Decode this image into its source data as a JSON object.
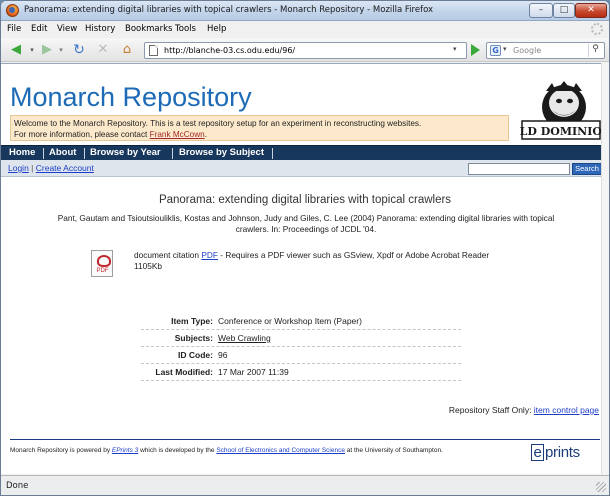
{
  "window": {
    "title": "Panorama: extending digital libraries with topical crawlers - Monarch Repository - Mozilla Firefox",
    "min_symbol": "–",
    "max_symbol": "□",
    "close_symbol": "✕"
  },
  "menubar": {
    "items": [
      "File",
      "Edit",
      "View",
      "History",
      "Bookmarks",
      "Tools",
      "Help"
    ]
  },
  "navbar": {
    "url": "http://blanche-03.cs.odu.edu/96/",
    "search_placeholder": "Google",
    "back_glyph": "◀",
    "forward_glyph": "▶",
    "reload_glyph": "↻",
    "stop_glyph": "✕",
    "home_glyph": "⌂",
    "dropdown_glyph": "▾",
    "search_glyph": "⚲"
  },
  "site": {
    "title": "Monarch Repository",
    "welcome_line1": "Welcome to the Monarch Repository. This is a test repository setup for an experiment in reconstructing websites.",
    "welcome_prefix": "For more information, please contact ",
    "contact_name": "Frank McCown",
    "welcome_suffix": ".",
    "logo_text": "OLD DOMINION"
  },
  "nav_menu": [
    "Home",
    "About",
    "Browse by Year",
    "Browse by Subject"
  ],
  "subbar": {
    "login": "Login",
    "separator": " | ",
    "create_account": "Create Account",
    "search_button": "Search"
  },
  "paper": {
    "title": "Panorama: extending digital libraries with topical crawlers",
    "citation": "Pant, Gautam and Tsioutsiouliklis, Kostas and Johnson, Judy and Giles, C. Lee (2004) Panorama: extending digital libraries with topical crawlers. In: Proceedings of JCDL '04.",
    "doc_prefix": "document citation ",
    "doc_link": "PDF",
    "doc_suffix": " - Requires a PDF viewer such as GSview, Xpdf or Adobe Acrobat Reader",
    "doc_size": "1105Kb",
    "pdf_icon_label": "PDF"
  },
  "metadata": [
    {
      "key": "Item Type:",
      "value": "Conference or Workshop Item (Paper)",
      "is_link": false
    },
    {
      "key": "Subjects:",
      "value": "Web Crawling",
      "is_link": true
    },
    {
      "key": "ID Code:",
      "value": "96",
      "is_link": false
    },
    {
      "key": "Last Modified:",
      "value": "17 Mar 2007 11:39",
      "is_link": false
    }
  ],
  "staff": {
    "label": "Repository Staff Only: ",
    "link": "item control page"
  },
  "footer": {
    "prefix": "Monarch Repository is powered by ",
    "eprints_link": "EPrints 3",
    "middle": " which is developed by the ",
    "school_link": "School of Electronics and Computer Science",
    "suffix": " at the University of Southampton.",
    "logo_e": "e",
    "logo_rest": "prints"
  },
  "status": {
    "text": "Done"
  }
}
